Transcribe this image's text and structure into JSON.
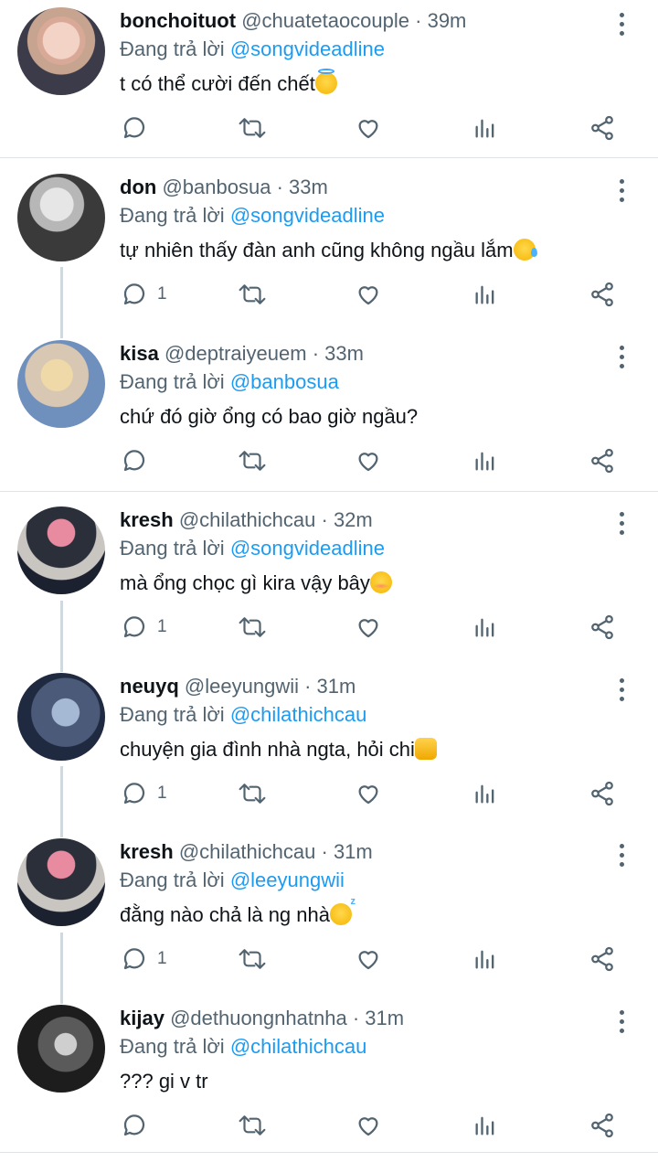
{
  "reply_prefix": "Đang trả lời",
  "colors": {
    "accent": "#1d9bf0",
    "muted": "#536471",
    "divider": "#dfe3e6"
  },
  "tweets": [
    {
      "name": "bonchoituot",
      "handle": "@chuatetaocouple",
      "time": "· 39m",
      "reply_to": "@songvideadline",
      "text": "t có thể cười đến chết",
      "emoji": "smiling-face-with-halo",
      "replies": ""
    },
    {
      "name": "don",
      "handle": "@banbosua",
      "time": "· 33m",
      "reply_to": "@songvideadline",
      "text": "tự nhiên thấy đàn anh cũng không ngầu lắm",
      "emoji": "smiling-face-with-tear",
      "replies": "1"
    },
    {
      "name": "kisa",
      "handle": "@deptraiyeuem",
      "time": "· 33m",
      "reply_to": "@banbosua",
      "text": "chứ đó giờ ổng có bao giờ ngầu?",
      "emoji": "",
      "replies": ""
    },
    {
      "name": "kresh",
      "handle": "@chilathichcau",
      "time": "· 32m",
      "reply_to": "@songvideadline",
      "text": "mà ổng chọc gì kira vậy bây",
      "emoji": "smiling-face",
      "replies": "1"
    },
    {
      "name": "neuyq",
      "handle": "@leeyungwii",
      "time": "· 31m",
      "reply_to": "@chilathichcau",
      "text": "chuyện gia đình nhà ngta, hỏi chi",
      "emoji": "oncoming-fist",
      "replies": "1"
    },
    {
      "name": "kresh",
      "handle": "@chilathichcau",
      "time": "· 31m",
      "reply_to": "@leeyungwii",
      "text": "đằng nào chả là ng nhà",
      "emoji": "sleepy-face",
      "replies": "1"
    },
    {
      "name": "kijay",
      "handle": "@dethuongnhatnha",
      "time": "· 31m",
      "reply_to": "@chilathichcau",
      "text": "??? gi v tr",
      "emoji": "",
      "replies": ""
    }
  ],
  "icons": [
    "reply-icon",
    "retweet-icon",
    "like-icon",
    "views-icon",
    "share-icon",
    "more-icon"
  ]
}
